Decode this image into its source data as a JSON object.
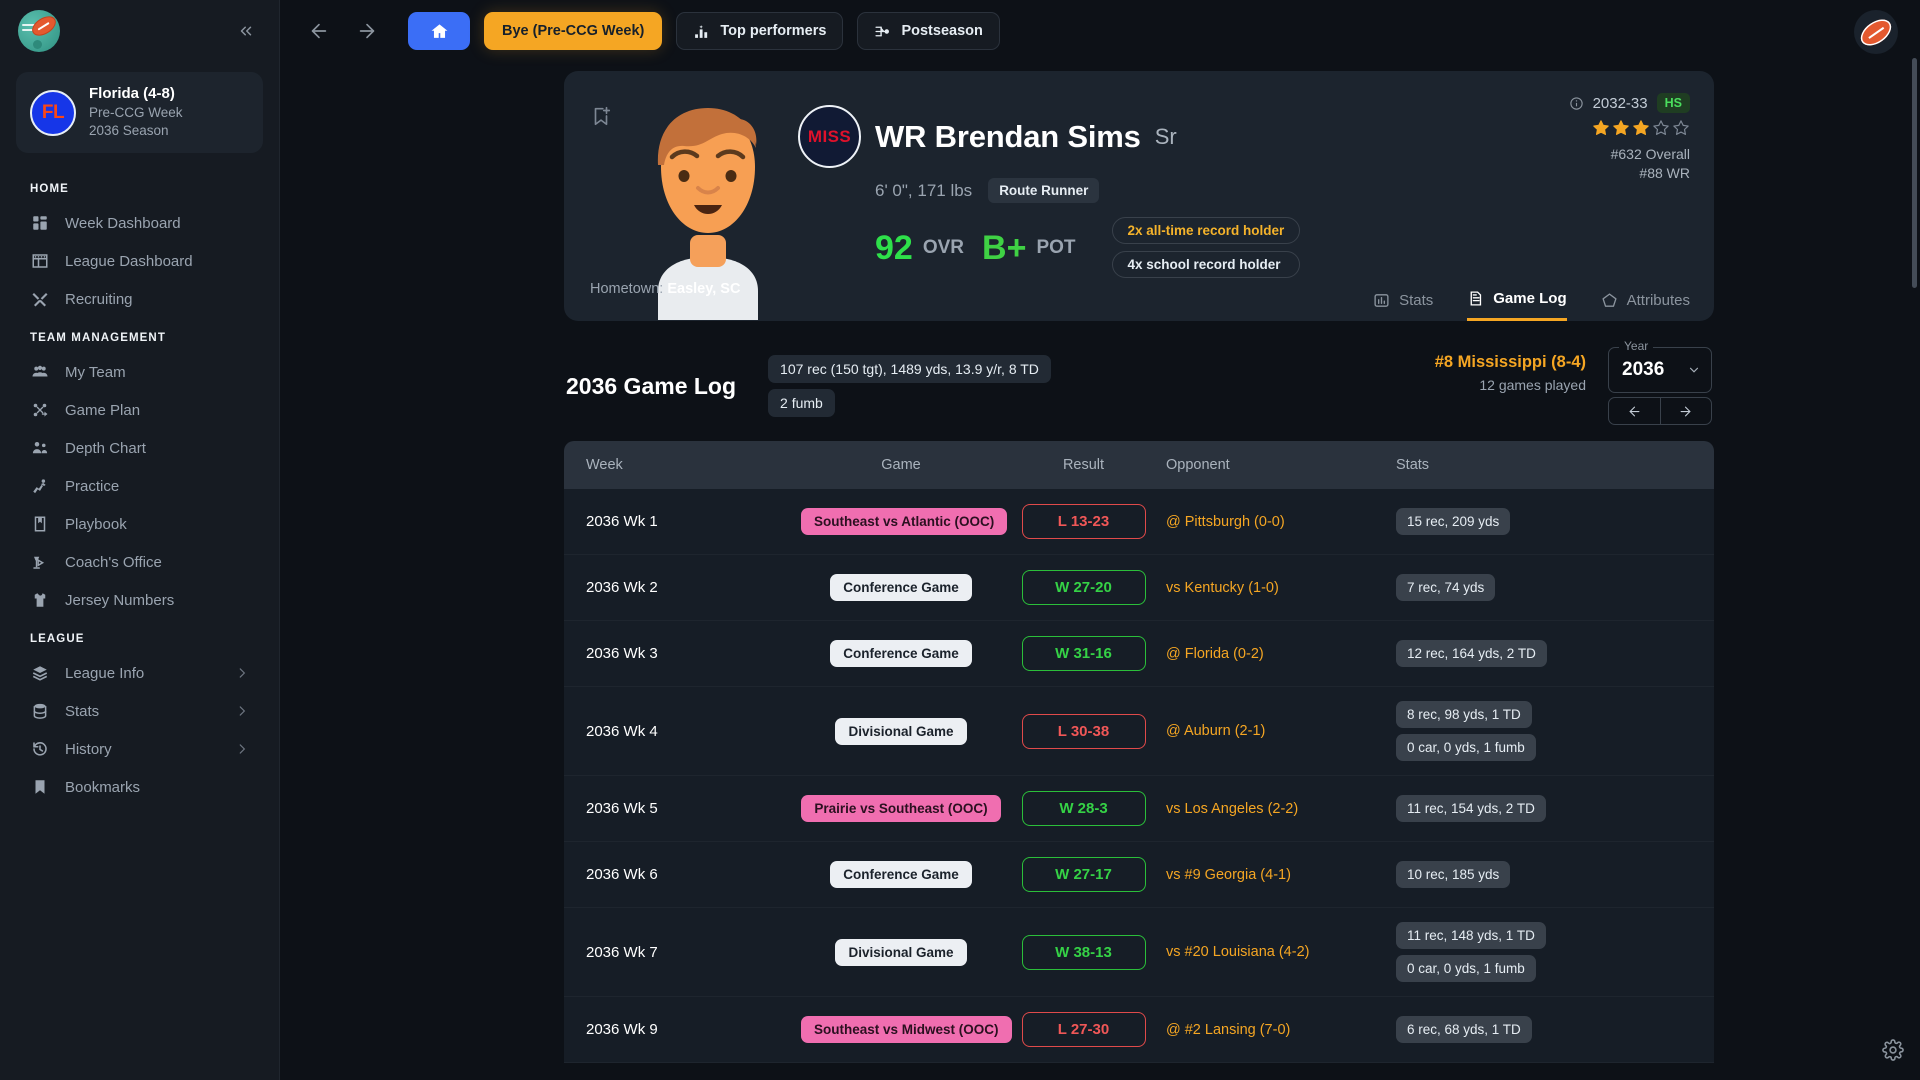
{
  "sidebar": {
    "brand_icon": "football-logo",
    "collapse_icon": "chevrons-left-icon",
    "team": {
      "abbr": "FL",
      "name": "Florida (4-8)",
      "week": "Pre-CCG Week",
      "season": "2036 Season"
    },
    "sections": [
      {
        "label": "HOME",
        "items": [
          {
            "label": "Week Dashboard",
            "icon": "dashboard-icon",
            "chevron": false
          },
          {
            "label": "League Dashboard",
            "icon": "table-icon",
            "chevron": false
          },
          {
            "label": "Recruiting",
            "icon": "whistle-icon",
            "chevron": false
          }
        ]
      },
      {
        "label": "TEAM MANAGEMENT",
        "items": [
          {
            "label": "My Team",
            "icon": "users-icon",
            "chevron": false
          },
          {
            "label": "Game Plan",
            "icon": "strategy-icon",
            "chevron": false
          },
          {
            "label": "Depth Chart",
            "icon": "people-icon",
            "chevron": false
          },
          {
            "label": "Practice",
            "icon": "practice-icon",
            "chevron": false
          },
          {
            "label": "Playbook",
            "icon": "book-icon",
            "chevron": false
          },
          {
            "label": "Coach's Office",
            "icon": "desk-lamp-icon",
            "chevron": false
          },
          {
            "label": "Jersey Numbers",
            "icon": "jersey-icon",
            "chevron": false
          }
        ]
      },
      {
        "label": "LEAGUE",
        "items": [
          {
            "label": "League Info",
            "icon": "layers-icon",
            "chevron": true
          },
          {
            "label": "Stats",
            "icon": "database-icon",
            "chevron": true
          },
          {
            "label": "History",
            "icon": "history-icon",
            "chevron": true
          },
          {
            "label": "Bookmarks",
            "icon": "bookmark-icon",
            "chevron": false
          }
        ]
      }
    ]
  },
  "topbar": {
    "back_icon": "arrow-left-icon",
    "forward_icon": "arrow-right-icon",
    "home_icon": "home-icon",
    "bye_label": "Bye (Pre-CCG Week)",
    "top_performers_label": "Top performers",
    "top_performers_icon": "bar-chart-icon",
    "postseason_label": "Postseason",
    "postseason_icon": "bracket-icon",
    "corner_icon": "football-icon"
  },
  "player": {
    "bookmark_icon": "bookmark-add-icon",
    "team_badge": "MISS",
    "name": "WR Brendan Sims",
    "class": "Sr",
    "height_weight": "6' 0\", 171 lbs",
    "trait": "Route Runner",
    "ovr_value": "92",
    "ovr_label": "OVR",
    "pot_value": "B+",
    "pot_label": "POT",
    "records": [
      {
        "label": "2x all-time record holder",
        "style": "gold"
      },
      {
        "label": "4x school record holder",
        "style": "plain"
      }
    ],
    "hometown_label": "Hometown:",
    "hometown_value": "Easley, SC",
    "recruit": {
      "info_icon": "info-icon",
      "years": "2032-33",
      "level": "HS",
      "stars_filled": 3,
      "stars_total": 5,
      "overall_rank": "#632 Overall",
      "position_rank": "#88 WR"
    },
    "tabs": [
      {
        "label": "Stats",
        "icon": "bar-chart-icon",
        "active": false
      },
      {
        "label": "Game Log",
        "icon": "document-icon",
        "active": true
      },
      {
        "label": "Attributes",
        "icon": "pentagon-icon",
        "active": false
      }
    ]
  },
  "gamelog": {
    "title": "2036 Game Log",
    "summary_chips": [
      "107 rec (150 tgt), 1489 yds, 13.9 y/r, 8 TD",
      "2 fumb"
    ],
    "opponent_team": "#8 Mississippi (8-4)",
    "games_played": "12 games played",
    "year_label": "Year",
    "year_value": "2036",
    "year_prev_icon": "arrow-left-icon",
    "year_next_icon": "arrow-right-icon",
    "dropdown_icon": "chevron-down-icon",
    "columns": [
      "Week",
      "Game",
      "Result",
      "Opponent",
      "Stats"
    ],
    "rows": [
      {
        "week": "2036 Wk 1",
        "game": "Southeast vs Atlantic (OOC)",
        "game_type": "ooc",
        "result": "L 13-23",
        "result_type": "l",
        "opponent": "@ Pittsburgh (0-0)",
        "stats": [
          "15 rec, 209 yds"
        ]
      },
      {
        "week": "2036 Wk 2",
        "game": "Conference Game",
        "game_type": "conf",
        "result": "W 27-20",
        "result_type": "w",
        "opponent": "vs Kentucky (1-0)",
        "stats": [
          "7 rec, 74 yds"
        ]
      },
      {
        "week": "2036 Wk 3",
        "game": "Conference Game",
        "game_type": "conf",
        "result": "W 31-16",
        "result_type": "w",
        "opponent": "@ Florida (0-2)",
        "stats": [
          "12 rec, 164 yds, 2 TD"
        ]
      },
      {
        "week": "2036 Wk 4",
        "game": "Divisional Game",
        "game_type": "div",
        "result": "L 30-38",
        "result_type": "l",
        "opponent": "@ Auburn (2-1)",
        "stats": [
          "8 rec, 98 yds, 1 TD",
          "0 car, 0 yds, 1 fumb"
        ]
      },
      {
        "week": "2036 Wk 5",
        "game": "Prairie vs Southeast (OOC)",
        "game_type": "ooc",
        "result": "W 28-3",
        "result_type": "w",
        "opponent": "vs Los Angeles (2-2)",
        "stats": [
          "11 rec, 154 yds, 2 TD"
        ]
      },
      {
        "week": "2036 Wk 6",
        "game": "Conference Game",
        "game_type": "conf",
        "result": "W 27-17",
        "result_type": "w",
        "opponent": "vs #9 Georgia (4-1)",
        "stats": [
          "10 rec, 185 yds"
        ]
      },
      {
        "week": "2036 Wk 7",
        "game": "Divisional Game",
        "game_type": "div",
        "result": "W 38-13",
        "result_type": "w",
        "opponent": "vs #20 Louisiana (4-2)",
        "stats": [
          "11 rec, 148 yds, 1 TD",
          "0 car, 0 yds, 1 fumb"
        ]
      },
      {
        "week": "2036 Wk 9",
        "game": "Southeast vs Midwest (OOC)",
        "game_type": "ooc",
        "result": "L 27-30",
        "result_type": "l",
        "opponent": "@ #2 Lansing (7-0)",
        "stats": [
          "6 rec, 68 yds, 1 TD"
        ]
      }
    ]
  },
  "footer": {
    "settings_icon": "gear-icon"
  }
}
